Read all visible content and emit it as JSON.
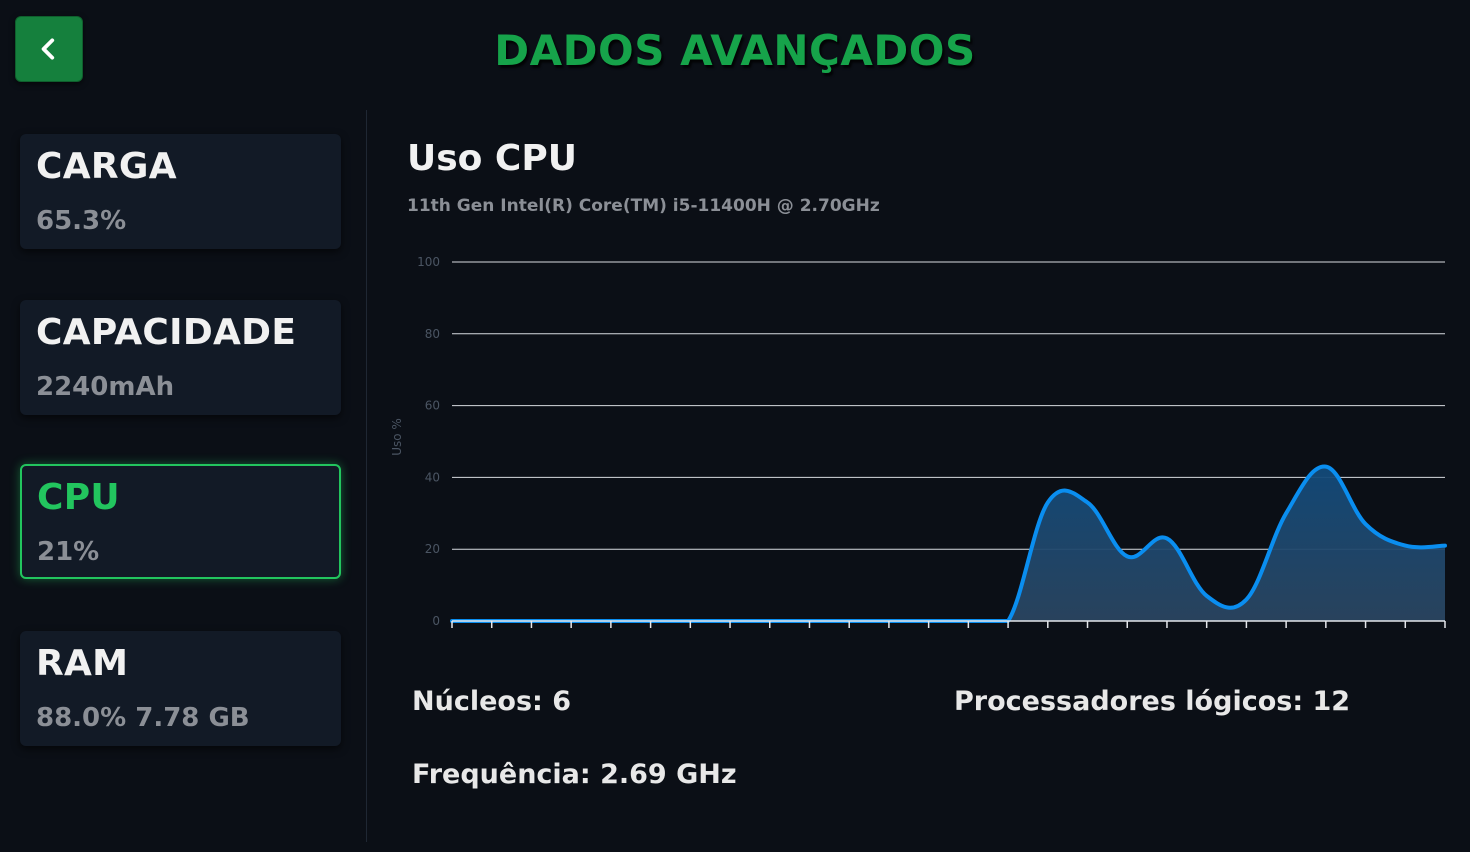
{
  "header": {
    "title": "DADOS AVANÇADOS",
    "back_icon": "chevron-left-icon"
  },
  "colors": {
    "accent": "#16a34a",
    "accent_bright": "#22c55e",
    "background": "#0b0f16",
    "card": "#121a26",
    "chart_line": "#0a8ef0"
  },
  "sidebar": {
    "items": [
      {
        "label": "CARGA",
        "value": "65.3%"
      },
      {
        "label": "CAPACIDADE",
        "value": "2240mAh"
      },
      {
        "label": "CPU",
        "value": "21%",
        "active": true
      },
      {
        "label": "RAM",
        "value": "88.0% 7.78 GB"
      }
    ]
  },
  "main": {
    "title": "Uso CPU",
    "subtitle": "11th Gen Intel(R) Core(TM) i5-11400H @ 2.70GHz",
    "cores": "Núcleos: 6",
    "logical": "Processadores lógicos: 12",
    "frequency": "Frequência: 2.69 GHz"
  },
  "chart_data": {
    "type": "area",
    "ylabel": "Uso %",
    "xlabel": "",
    "ylim": [
      0,
      100
    ],
    "yticks": [
      0,
      20,
      40,
      60,
      80,
      100
    ],
    "x_ticks_count": 26,
    "grid": true,
    "series": [
      {
        "values": [
          0,
          0,
          0,
          0,
          0,
          0,
          0,
          0,
          0,
          0,
          0,
          0,
          0,
          0,
          0,
          33,
          33,
          18,
          23,
          7,
          6,
          30,
          43,
          27,
          21,
          21
        ]
      }
    ]
  }
}
